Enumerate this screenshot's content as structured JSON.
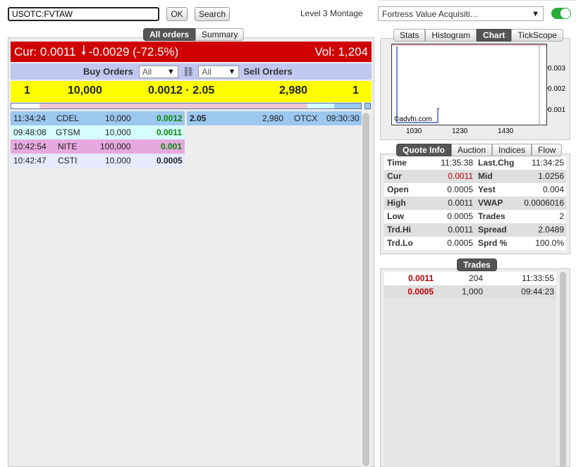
{
  "header": {
    "symbol": "USOTC:FVTAW",
    "ok_label": "OK",
    "search_label": "Search",
    "montage_title": "Level 3 Montage",
    "company_select": "Fortress Value Acquisiti…"
  },
  "left_tabs": [
    "All orders",
    "Summary"
  ],
  "cur_bar": {
    "cur": "Cur: 0.0011",
    "arrow": "🡓",
    "change": "-0.0029 (-72.5%)",
    "vol": "Vol: 1,204"
  },
  "order_header": {
    "buy_label": "Buy Orders",
    "buy_filter": "All",
    "link_icon": "⛓",
    "sell_filter": "All",
    "sell_label": "Sell Orders"
  },
  "best": {
    "bid_count": "1",
    "bid_size": "10,000",
    "prices": "0.0012 · 2.05",
    "ask_size": "2,980",
    "ask_count": "1"
  },
  "bids": [
    {
      "time": "11:34:24",
      "mm": "CDEL",
      "size": "10,000",
      "price": "0.0012",
      "color": "#9cc7ef",
      "price_color": "green"
    },
    {
      "time": "09:48:08",
      "mm": "GTSM",
      "size": "10,000",
      "price": "0.0011",
      "color": "#d5fdfd",
      "price_color": "green"
    },
    {
      "time": "10:42:54",
      "mm": "NITE",
      "size": "100,000",
      "price": "0.001",
      "color": "#e6a8df",
      "price_color": "green"
    },
    {
      "time": "10:42:47",
      "mm": "CSTI",
      "size": "10,000",
      "price": "0.0005",
      "color": "#e6e9ff",
      "price_color": "dark"
    }
  ],
  "asks": [
    {
      "price": "2.05",
      "size": "2,980",
      "mm": "OTCX",
      "time": "09:30:30"
    }
  ],
  "chart_tabs": [
    "Stats",
    "Histogram",
    "Chart",
    "TickScope"
  ],
  "chart": {
    "yticks": [
      "0.003",
      "0.002",
      "0.001"
    ],
    "xticks": [
      "1030",
      "1230",
      "1430"
    ],
    "watermark": "©advfn.com"
  },
  "quote_tabs": [
    "Quote Info",
    "Auction",
    "Indices",
    "Flow"
  ],
  "quote": [
    {
      "l1": "Time",
      "v1": "11:35:38",
      "l2": "Last.Chg",
      "v2": "11:34:25",
      "v1_red": false
    },
    {
      "l1": "Cur",
      "v1": "0.0011",
      "l2": "Mid",
      "v2": "1.0256",
      "v1_red": true
    },
    {
      "l1": "Open",
      "v1": "0.0005",
      "l2": "Yest",
      "v2": "0.004",
      "v1_red": false
    },
    {
      "l1": "High",
      "v1": "0.0011",
      "l2": "VWAP",
      "v2": "0.0006016",
      "v1_red": false
    },
    {
      "l1": "Low",
      "v1": "0.0005",
      "l2": "Trades",
      "v2": "2",
      "v1_red": false
    },
    {
      "l1": "Trd.Hi",
      "v1": "0.0011",
      "l2": "Spread",
      "v2": "2.0489",
      "v1_red": false
    },
    {
      "l1": "Trd.Lo",
      "v1": "0.0005",
      "l2": "Sprd %",
      "v2": "100.0%",
      "v1_red": false
    }
  ],
  "trades_tab": "Trades",
  "trades": [
    {
      "price": "0.0011",
      "size": "204",
      "time": "11:33:55"
    },
    {
      "price": "0.0005",
      "size": "1,000",
      "time": "09:44:23"
    }
  ],
  "colors": {
    "cur_bar": "#d10000",
    "order_header": "#c0c8f0",
    "best_bar": "#ffff00",
    "toggle_on": "#27ae3a"
  }
}
